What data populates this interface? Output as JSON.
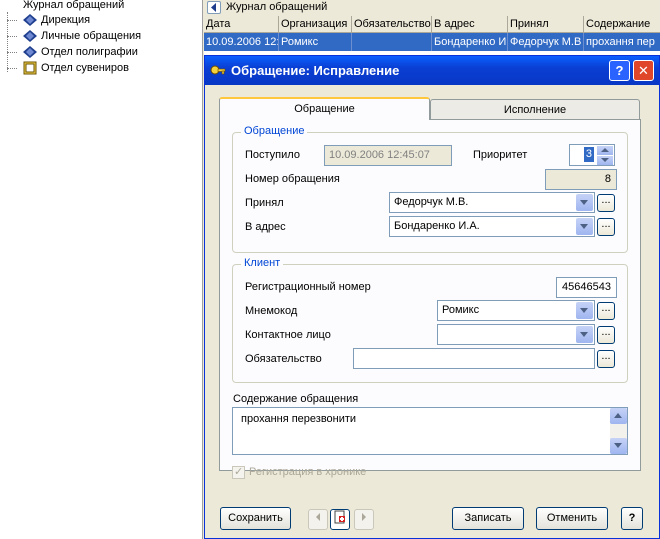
{
  "tree": {
    "root": "Журнал обращений",
    "items": [
      "Дирекция",
      "Личные обращения",
      "Отдел полиграфии",
      "Отдел сувениров"
    ]
  },
  "journal": {
    "title": "Журнал обращений",
    "columns": [
      "Дата",
      "Организация",
      "Обязательство",
      "В адрес",
      "Принял",
      "Содержание"
    ],
    "row": [
      "10.09.2006 12:",
      "Ромикс",
      "",
      "Бондаренко И",
      "Федорчук М.В",
      "прохання пер"
    ]
  },
  "dialog": {
    "title": "Обращение: Исправление",
    "help_glyph": "?",
    "close_glyph": "✕",
    "tabs": [
      "Обращение",
      "Исполнение"
    ],
    "group_request": {
      "caption": "Обращение",
      "received_label": "Поступило",
      "received_value": "10.09.2006 12:45:07",
      "priority_label": "Приоритет",
      "priority_value": "3",
      "number_label": "Номер обращения",
      "number_value": "8",
      "accepted_label": "Принял",
      "accepted_value": "Федорчук М.В.",
      "address_label": "В адрес",
      "address_value": "Бондаренко И.А."
    },
    "group_client": {
      "caption": "Клиент",
      "regnum_label": "Регистрационный номер",
      "regnum_value": "45646543",
      "mnemo_label": "Мнемокод",
      "mnemo_value": "Ромикс",
      "contact_label": "Контактное лицо",
      "contact_value": "",
      "obligation_label": "Обязательство",
      "obligation_value": ""
    },
    "content_label": "Содержание обращения",
    "content_value": "прохання перезвонити",
    "chronicle_label": "Регистрация в хронике",
    "buttons": {
      "save": "Сохранить",
      "record": "Записать",
      "cancel": "Отменить",
      "help": "?",
      "dots": "..."
    }
  }
}
